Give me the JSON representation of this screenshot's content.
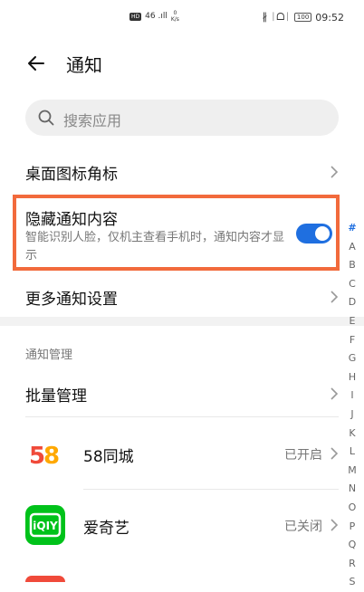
{
  "status_bar": {
    "hd": "HD",
    "signal": "46 .ıll",
    "speed_value": "0",
    "speed_unit": "K/s",
    "icons": "∦ ᛁᗝᛁ",
    "battery": "100",
    "time": "09:52"
  },
  "header": {
    "title": "通知"
  },
  "search": {
    "placeholder": "搜索应用"
  },
  "settings": {
    "badge_label": "桌面图标角标",
    "hide_content": {
      "title": "隐藏通知内容",
      "description": "智能识别人脸，仅机主查看手机时，通知内容才显示",
      "enabled": true
    },
    "more_label": "更多通知设置"
  },
  "management": {
    "section_title": "通知管理",
    "batch_label": "批量管理"
  },
  "apps": [
    {
      "name": "58同城",
      "status": "已开启",
      "icon": "58-app-icon",
      "logo": "58",
      "color": "#ffffff"
    },
    {
      "name": "爱奇艺",
      "status": "已关闭",
      "icon": "iqiyi-app-icon",
      "logo": "iQIY",
      "color": "#00c21a"
    }
  ],
  "alpha_index": [
    "#",
    "A",
    "B",
    "C",
    "D",
    "E",
    "F",
    "G",
    "H",
    "I",
    "J",
    "K",
    "L",
    "M",
    "N",
    "O",
    "P",
    "Q",
    "R",
    "S"
  ],
  "colors": {
    "accent": "#1f6fe0",
    "highlight": "#f26a3c"
  }
}
